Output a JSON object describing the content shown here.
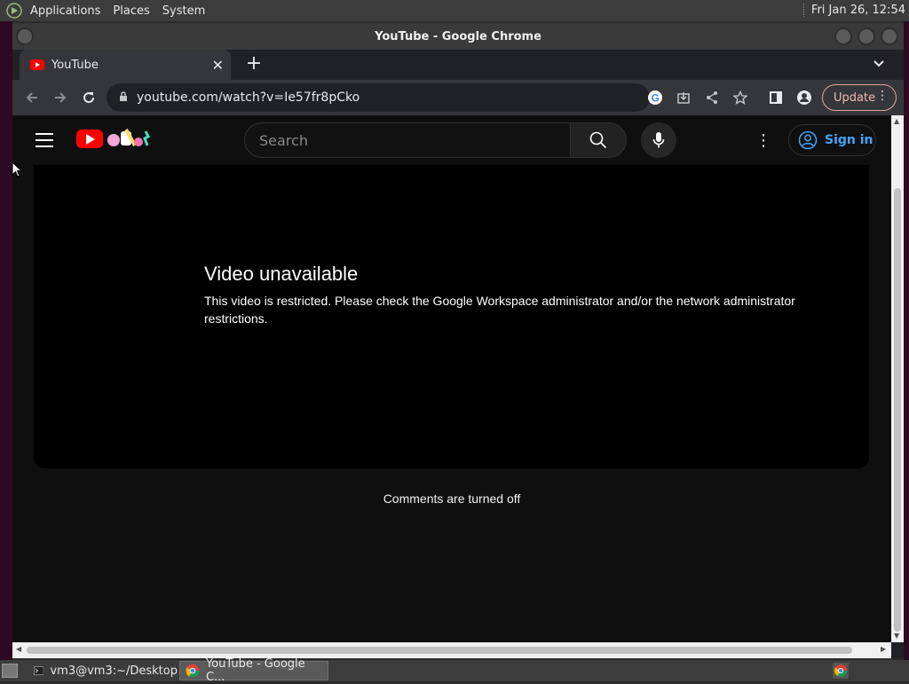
{
  "top_panel": {
    "menus": [
      "Applications",
      "Places",
      "System"
    ],
    "clock": "Fri Jan 26, 12:54"
  },
  "window": {
    "title": "YouTube - Google Chrome"
  },
  "tabs": [
    {
      "label": "YouTube",
      "favicon": "youtube-icon"
    }
  ],
  "toolbar": {
    "url": "youtube.com/watch?v=Ie57fr8pCko",
    "update_label": "Update"
  },
  "youtube": {
    "search_placeholder": "Search",
    "signin_label": "Sign in",
    "video_title": "Video unavailable",
    "video_message": "This video is restricted. Please check the Google Workspace administrator and/or the network administrator restrictions.",
    "comments_text": "Comments are turned off"
  },
  "taskbar": {
    "items": [
      {
        "label": "vm3@vm3:~/Desktop",
        "icon": "terminal-icon"
      },
      {
        "label": "YouTube - Google C...",
        "icon": "chrome-icon"
      }
    ]
  },
  "colors": {
    "youtube_red": "#ff0000",
    "link_blue": "#3ea6ff",
    "update_accent": "#f2b8b5"
  }
}
